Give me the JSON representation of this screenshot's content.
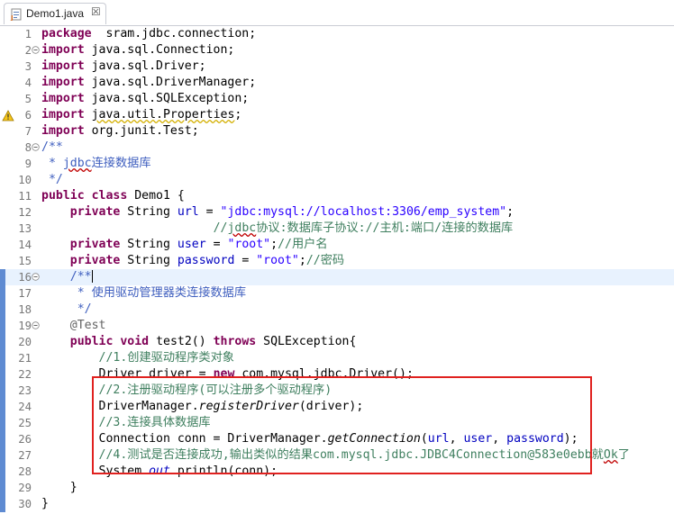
{
  "tab": {
    "label": "Demo1.java",
    "close": "☒"
  },
  "lines": [
    {
      "n": "1",
      "segs": [
        [
          "kw",
          "package"
        ],
        [
          "",
          "  sram.jdbc.connection;"
        ]
      ]
    },
    {
      "n": "2",
      "segs": [
        [
          "kw",
          "import"
        ],
        [
          "",
          " java.sql.Connection;"
        ]
      ]
    },
    {
      "n": "3",
      "segs": [
        [
          "kw",
          "import"
        ],
        [
          "",
          " java.sql.Driver;"
        ]
      ]
    },
    {
      "n": "4",
      "segs": [
        [
          "kw",
          "import"
        ],
        [
          "",
          " java.sql.DriverManager;"
        ]
      ]
    },
    {
      "n": "5",
      "segs": [
        [
          "kw",
          "import"
        ],
        [
          "",
          " java.sql.SQLException;"
        ]
      ]
    },
    {
      "n": "6",
      "segs": [
        [
          "kw",
          "import"
        ],
        [
          "",
          " "
        ],
        [
          "wavy",
          "java.util.Properties"
        ],
        [
          "",
          ";"
        ]
      ]
    },
    {
      "n": "7",
      "segs": [
        [
          "kw",
          "import"
        ],
        [
          "",
          " org.junit.Test;"
        ]
      ]
    },
    {
      "n": "8",
      "segs": [
        [
          "jdoc",
          "/**"
        ]
      ]
    },
    {
      "n": "9",
      "segs": [
        [
          "jdoc",
          " * "
        ],
        [
          "jdoc wavy2",
          "jdbc"
        ],
        [
          "jdoc",
          "连接数据库"
        ]
      ]
    },
    {
      "n": "10",
      "segs": [
        [
          "jdoc",
          " */"
        ]
      ]
    },
    {
      "n": "11",
      "segs": [
        [
          "kw",
          "public"
        ],
        [
          "",
          " "
        ],
        [
          "kw",
          "class"
        ],
        [
          "",
          " Demo1 {"
        ]
      ]
    },
    {
      "n": "12",
      "segs": [
        [
          "",
          "    "
        ],
        [
          "kw",
          "private"
        ],
        [
          "",
          " String "
        ],
        [
          "fld",
          "url"
        ],
        [
          "",
          " = "
        ],
        [
          "str",
          "\"jdbc:mysql://localhost:3306/emp_system\""
        ],
        [
          "",
          ";"
        ]
      ]
    },
    {
      "n": "13",
      "segs": [
        [
          "",
          "                        "
        ],
        [
          "cmt",
          "//"
        ],
        [
          "cmt wavy2",
          "jdbc"
        ],
        [
          "cmt",
          "协议:数据库子协议://主机:端口/连接的数据库"
        ]
      ]
    },
    {
      "n": "14",
      "segs": [
        [
          "",
          "    "
        ],
        [
          "kw",
          "private"
        ],
        [
          "",
          " String "
        ],
        [
          "fld",
          "user"
        ],
        [
          "",
          " = "
        ],
        [
          "str",
          "\"root\""
        ],
        [
          "",
          ";"
        ],
        [
          "cmt",
          "//用户名"
        ]
      ]
    },
    {
      "n": "15",
      "segs": [
        [
          "",
          "    "
        ],
        [
          "kw",
          "private"
        ],
        [
          "",
          " String "
        ],
        [
          "fld",
          "password"
        ],
        [
          "",
          " = "
        ],
        [
          "str",
          "\"root\""
        ],
        [
          "",
          ";"
        ],
        [
          "cmt",
          "//密码"
        ]
      ]
    },
    {
      "n": "16",
      "segs": [
        [
          "",
          "    "
        ],
        [
          "jdoc",
          "/**"
        ]
      ]
    },
    {
      "n": "17",
      "segs": [
        [
          "jdoc",
          "     * 使用驱动管理器类连接数据库"
        ]
      ]
    },
    {
      "n": "18",
      "segs": [
        [
          "jdoc",
          "     */"
        ]
      ]
    },
    {
      "n": "19",
      "segs": [
        [
          "",
          "    "
        ],
        [
          "ann",
          "@Test"
        ]
      ]
    },
    {
      "n": "20",
      "segs": [
        [
          "",
          "    "
        ],
        [
          "kw",
          "public"
        ],
        [
          "",
          " "
        ],
        [
          "kw",
          "void"
        ],
        [
          "",
          " test2() "
        ],
        [
          "kw",
          "throws"
        ],
        [
          "",
          " SQLException{"
        ]
      ]
    },
    {
      "n": "21",
      "segs": [
        [
          "",
          "        "
        ],
        [
          "cmt",
          "//1.创建驱动程序类对象"
        ]
      ]
    },
    {
      "n": "22",
      "segs": [
        [
          "",
          "        Driver driver = "
        ],
        [
          "kw",
          "new"
        ],
        [
          "",
          " com.mysql.jdbc.Driver();"
        ]
      ]
    },
    {
      "n": "23",
      "segs": [
        [
          "",
          "        "
        ],
        [
          "cmt",
          "//2.注册驱动程序(可以注册多个驱动程序)"
        ]
      ]
    },
    {
      "n": "24",
      "segs": [
        [
          "",
          "        DriverManager."
        ],
        [
          "it",
          "registerDriver"
        ],
        [
          "",
          "(driver);"
        ]
      ]
    },
    {
      "n": "25",
      "segs": [
        [
          "",
          "        "
        ],
        [
          "cmt",
          "//3.连接具体数据库"
        ]
      ]
    },
    {
      "n": "26",
      "segs": [
        [
          "",
          "        Connection conn = DriverManager."
        ],
        [
          "it",
          "getConnection"
        ],
        [
          "",
          "("
        ],
        [
          "fld",
          "url"
        ],
        [
          "",
          ", "
        ],
        [
          "fld",
          "user"
        ],
        [
          "",
          ", "
        ],
        [
          "fld",
          "password"
        ],
        [
          "",
          ");"
        ]
      ]
    },
    {
      "n": "27",
      "segs": [
        [
          "",
          "        "
        ],
        [
          "cmt",
          "//4.测试是否连接成功,输出类似的结果com.mysql.jdbc.JDBC4Connection@583e0ebb就"
        ],
        [
          "cmt wavy2",
          "Ok"
        ],
        [
          "cmt",
          "了"
        ]
      ]
    },
    {
      "n": "28",
      "segs": [
        [
          "",
          "        System."
        ],
        [
          "fld it",
          "out"
        ],
        [
          "",
          ".println(conn);"
        ]
      ]
    },
    {
      "n": "29",
      "segs": [
        [
          "",
          "    }"
        ]
      ]
    },
    {
      "n": "30",
      "segs": [
        [
          "",
          "}"
        ]
      ]
    }
  ]
}
